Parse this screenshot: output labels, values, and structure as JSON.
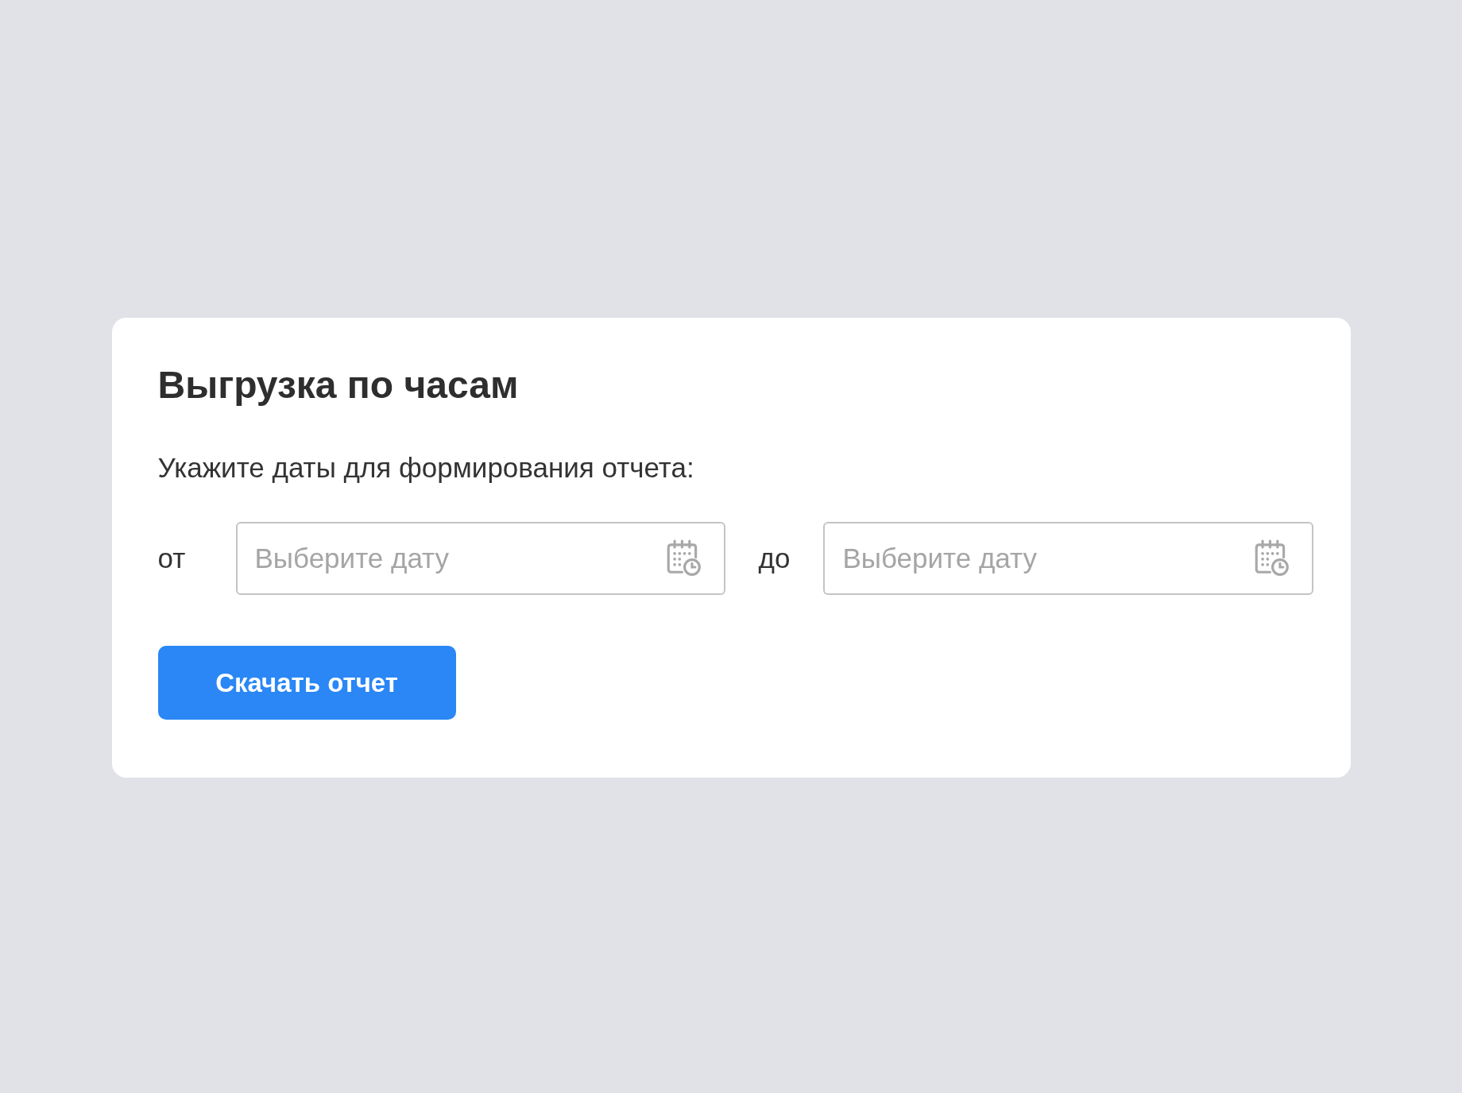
{
  "card": {
    "title": "Выгрузка по часам",
    "instruction": "Укажите даты для формирования отчета:",
    "date_range": [
      {
        "label": "от",
        "placeholder": "Выберите дату"
      },
      {
        "label": "до",
        "placeholder": "Выберите дату"
      }
    ],
    "button": "Скачать отчет"
  }
}
